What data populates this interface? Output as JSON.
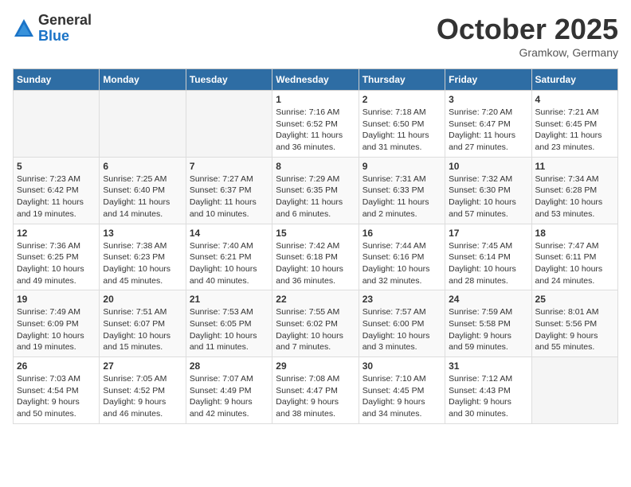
{
  "header": {
    "logo": {
      "general": "General",
      "blue": "Blue"
    },
    "title": "October 2025",
    "location": "Gramkow, Germany"
  },
  "calendar": {
    "days_of_week": [
      "Sunday",
      "Monday",
      "Tuesday",
      "Wednesday",
      "Thursday",
      "Friday",
      "Saturday"
    ],
    "weeks": [
      [
        {
          "day": "",
          "info": ""
        },
        {
          "day": "",
          "info": ""
        },
        {
          "day": "",
          "info": ""
        },
        {
          "day": "1",
          "info": "Sunrise: 7:16 AM\nSunset: 6:52 PM\nDaylight: 11 hours\nand 36 minutes."
        },
        {
          "day": "2",
          "info": "Sunrise: 7:18 AM\nSunset: 6:50 PM\nDaylight: 11 hours\nand 31 minutes."
        },
        {
          "day": "3",
          "info": "Sunrise: 7:20 AM\nSunset: 6:47 PM\nDaylight: 11 hours\nand 27 minutes."
        },
        {
          "day": "4",
          "info": "Sunrise: 7:21 AM\nSunset: 6:45 PM\nDaylight: 11 hours\nand 23 minutes."
        }
      ],
      [
        {
          "day": "5",
          "info": "Sunrise: 7:23 AM\nSunset: 6:42 PM\nDaylight: 11 hours\nand 19 minutes."
        },
        {
          "day": "6",
          "info": "Sunrise: 7:25 AM\nSunset: 6:40 PM\nDaylight: 11 hours\nand 14 minutes."
        },
        {
          "day": "7",
          "info": "Sunrise: 7:27 AM\nSunset: 6:37 PM\nDaylight: 11 hours\nand 10 minutes."
        },
        {
          "day": "8",
          "info": "Sunrise: 7:29 AM\nSunset: 6:35 PM\nDaylight: 11 hours\nand 6 minutes."
        },
        {
          "day": "9",
          "info": "Sunrise: 7:31 AM\nSunset: 6:33 PM\nDaylight: 11 hours\nand 2 minutes."
        },
        {
          "day": "10",
          "info": "Sunrise: 7:32 AM\nSunset: 6:30 PM\nDaylight: 10 hours\nand 57 minutes."
        },
        {
          "day": "11",
          "info": "Sunrise: 7:34 AM\nSunset: 6:28 PM\nDaylight: 10 hours\nand 53 minutes."
        }
      ],
      [
        {
          "day": "12",
          "info": "Sunrise: 7:36 AM\nSunset: 6:25 PM\nDaylight: 10 hours\nand 49 minutes."
        },
        {
          "day": "13",
          "info": "Sunrise: 7:38 AM\nSunset: 6:23 PM\nDaylight: 10 hours\nand 45 minutes."
        },
        {
          "day": "14",
          "info": "Sunrise: 7:40 AM\nSunset: 6:21 PM\nDaylight: 10 hours\nand 40 minutes."
        },
        {
          "day": "15",
          "info": "Sunrise: 7:42 AM\nSunset: 6:18 PM\nDaylight: 10 hours\nand 36 minutes."
        },
        {
          "day": "16",
          "info": "Sunrise: 7:44 AM\nSunset: 6:16 PM\nDaylight: 10 hours\nand 32 minutes."
        },
        {
          "day": "17",
          "info": "Sunrise: 7:45 AM\nSunset: 6:14 PM\nDaylight: 10 hours\nand 28 minutes."
        },
        {
          "day": "18",
          "info": "Sunrise: 7:47 AM\nSunset: 6:11 PM\nDaylight: 10 hours\nand 24 minutes."
        }
      ],
      [
        {
          "day": "19",
          "info": "Sunrise: 7:49 AM\nSunset: 6:09 PM\nDaylight: 10 hours\nand 19 minutes."
        },
        {
          "day": "20",
          "info": "Sunrise: 7:51 AM\nSunset: 6:07 PM\nDaylight: 10 hours\nand 15 minutes."
        },
        {
          "day": "21",
          "info": "Sunrise: 7:53 AM\nSunset: 6:05 PM\nDaylight: 10 hours\nand 11 minutes."
        },
        {
          "day": "22",
          "info": "Sunrise: 7:55 AM\nSunset: 6:02 PM\nDaylight: 10 hours\nand 7 minutes."
        },
        {
          "day": "23",
          "info": "Sunrise: 7:57 AM\nSunset: 6:00 PM\nDaylight: 10 hours\nand 3 minutes."
        },
        {
          "day": "24",
          "info": "Sunrise: 7:59 AM\nSunset: 5:58 PM\nDaylight: 9 hours\nand 59 minutes."
        },
        {
          "day": "25",
          "info": "Sunrise: 8:01 AM\nSunset: 5:56 PM\nDaylight: 9 hours\nand 55 minutes."
        }
      ],
      [
        {
          "day": "26",
          "info": "Sunrise: 7:03 AM\nSunset: 4:54 PM\nDaylight: 9 hours\nand 50 minutes."
        },
        {
          "day": "27",
          "info": "Sunrise: 7:05 AM\nSunset: 4:52 PM\nDaylight: 9 hours\nand 46 minutes."
        },
        {
          "day": "28",
          "info": "Sunrise: 7:07 AM\nSunset: 4:49 PM\nDaylight: 9 hours\nand 42 minutes."
        },
        {
          "day": "29",
          "info": "Sunrise: 7:08 AM\nSunset: 4:47 PM\nDaylight: 9 hours\nand 38 minutes."
        },
        {
          "day": "30",
          "info": "Sunrise: 7:10 AM\nSunset: 4:45 PM\nDaylight: 9 hours\nand 34 minutes."
        },
        {
          "day": "31",
          "info": "Sunrise: 7:12 AM\nSunset: 4:43 PM\nDaylight: 9 hours\nand 30 minutes."
        },
        {
          "day": "",
          "info": ""
        }
      ]
    ]
  }
}
